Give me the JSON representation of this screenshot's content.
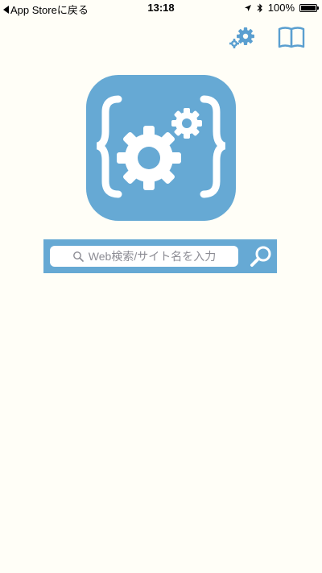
{
  "status_bar": {
    "back_label": "App Storeに戻る",
    "time": "13:18",
    "battery": "100%"
  },
  "toolbar": {
    "settings_icon": "gears-icon",
    "bookmarks_icon": "book-icon"
  },
  "logo": {
    "icon": "code-gears-logo",
    "color": "#66A9D4"
  },
  "search": {
    "placeholder": "Web検索/サイト名を入力",
    "button_icon": "magnifier-icon"
  },
  "colors": {
    "accent": "#66A9D4",
    "background": "#FFFEF7"
  }
}
